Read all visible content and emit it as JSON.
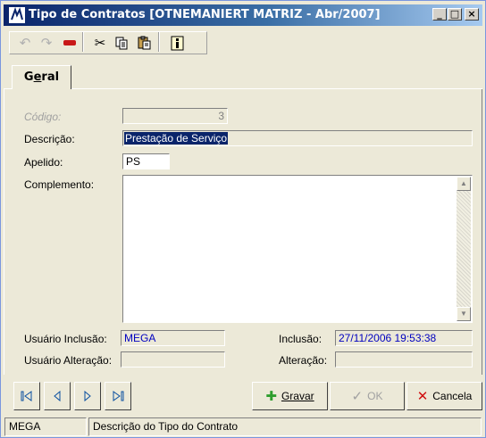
{
  "window": {
    "title": "Tipo de Contratos [OTNEMANIERT MATRIZ - Abr/2007]",
    "logo_text": "MEGA"
  },
  "titlebar_buttons": [
    "minimize-icon",
    "maximize-icon",
    "close-icon"
  ],
  "toolbar": {
    "icons": [
      "undo-icon",
      "redo-icon",
      "delete-icon",
      "cut-icon",
      "copy-icon",
      "paste-icon",
      "info-icon"
    ]
  },
  "tabs": [
    {
      "label": "Geral",
      "accel": "e"
    }
  ],
  "form": {
    "codigo_label": "Código:",
    "codigo_value": "3",
    "descricao_label": "Descrição:",
    "descricao_value": "Prestação de Serviço",
    "apelido_label": "Apelido:",
    "apelido_value": "PS",
    "complemento_label": "Complemento:",
    "complemento_value": "",
    "usuario_inclusao_label": "Usuário Inclusão:",
    "usuario_inclusao_value": "MEGA",
    "usuario_alteracao_label": "Usuário Alteração:",
    "usuario_alteracao_value": "",
    "inclusao_label": "Inclusão:",
    "inclusao_value": "27/11/2006 19:53:38",
    "alteracao_label": "Alteração:",
    "alteracao_value": ""
  },
  "nav": {
    "icons": [
      "first-record-icon",
      "previous-record-icon",
      "next-record-icon",
      "last-record-icon"
    ]
  },
  "actions": {
    "gravar": "Gravar",
    "ok": "OK",
    "cancela": "Cancela"
  },
  "status": {
    "user": "MEGA",
    "message": "Descrição do Tipo do Contrato"
  },
  "colors": {
    "title_bar": "#0a246a",
    "highlight": "#0a246a",
    "date_text": "#0000c0",
    "gravar_icon": "#2e9e2e",
    "cancel_icon": "#d01010"
  }
}
